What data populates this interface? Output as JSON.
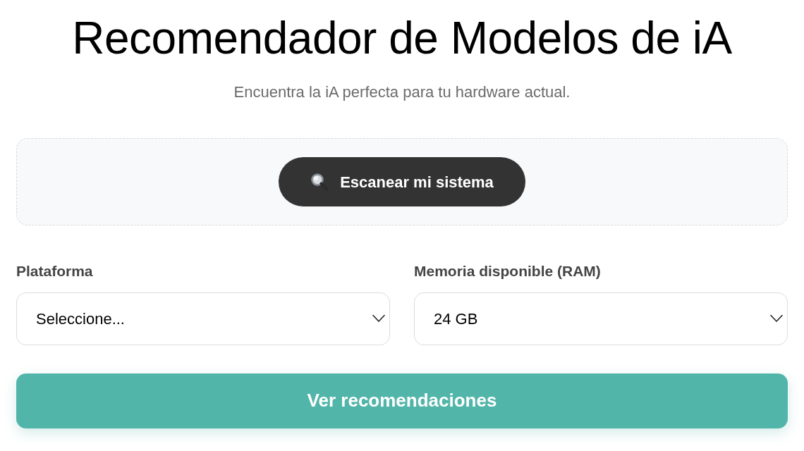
{
  "header": {
    "title": "Recomendador de Modelos de iA",
    "subtitle": "Encuentra la iA perfecta para tu hardware actual."
  },
  "scan_panel": {
    "button": {
      "label": "Escanear mi sistema"
    }
  },
  "fields": [
    {
      "label": "Plataforma",
      "value": "Seleccione..."
    },
    {
      "label": "Memoria disponible (RAM)",
      "value": "24 GB"
    }
  ],
  "submit_button": {
    "label": "Ver recomendaciones"
  }
}
